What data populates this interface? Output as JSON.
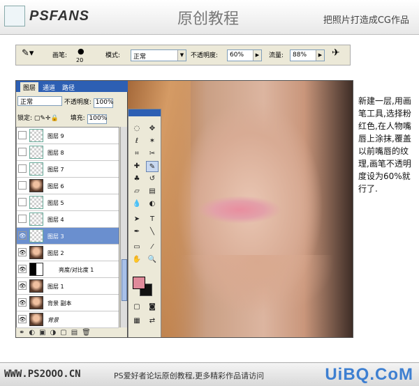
{
  "header": {
    "logo": "PSFANS",
    "title": "原创教程",
    "subtitle": "把照片打造成CG作品"
  },
  "options_bar": {
    "brush_label": "画笔:",
    "brush_size": "20",
    "mode_label": "模式:",
    "mode_value": "正常",
    "opacity_label": "不透明度:",
    "opacity_value": "60%",
    "flow_label": "流量:",
    "flow_value": "88%"
  },
  "layers_panel": {
    "tabs": [
      "图层",
      "通道",
      "路径"
    ],
    "blend_mode": "正常",
    "opacity_label": "不透明度:",
    "opacity_value": "100%",
    "lock_label": "锁定:",
    "fill_label": "填充:",
    "fill_value": "100%",
    "layers": [
      {
        "name": "图层 9",
        "thumb": "empty"
      },
      {
        "name": "图层 8",
        "thumb": "empty"
      },
      {
        "name": "图层 7",
        "thumb": "empty"
      },
      {
        "name": "图层 6",
        "thumb": "photo"
      },
      {
        "name": "图层 5",
        "thumb": "empty"
      },
      {
        "name": "图层 4",
        "thumb": "empty"
      },
      {
        "name": "图层 3",
        "thumb": "empty",
        "selected": true
      },
      {
        "name": "图层 2",
        "thumb": "photo"
      },
      {
        "name": "亮度/对比度 1",
        "thumb": "adjust"
      },
      {
        "name": "图层 1",
        "thumb": "photo"
      },
      {
        "name": "背景 副本",
        "thumb": "photo"
      },
      {
        "name": "背景",
        "thumb": "photo"
      }
    ]
  },
  "description": "新建一层,用画笔工具,选择粉红色,在人物嘴唇上涂抹,覆盖以前嘴唇的纹理,画笔不透明度设为60%就行了.",
  "footer": {
    "url": "WWW.PS2OOO.CN",
    "text": "PS爱好者论坛原创教程,更多精彩作品请访问",
    "watermark": "UiBQ.CoM"
  },
  "colors": {
    "foreground": "#e08a9a",
    "background": "#111111",
    "selection": "#6a8fcf"
  }
}
